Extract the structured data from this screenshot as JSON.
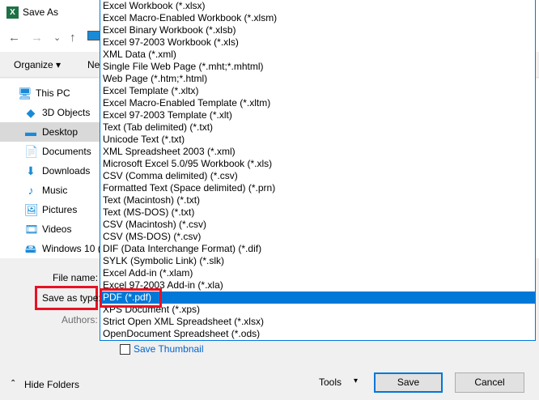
{
  "window": {
    "title": "Save As",
    "icon": "excel-icon"
  },
  "nav": {
    "back": "←",
    "forward": "→",
    "recent": "⌄",
    "up": "↑"
  },
  "toolbar": {
    "organize": "Organize ▾",
    "new_folder": "Ne"
  },
  "sidebar": {
    "items": [
      {
        "label": "This PC",
        "icon": "🖥"
      },
      {
        "label": "3D Objects",
        "icon": "◆"
      },
      {
        "label": "Desktop",
        "icon": "▬",
        "selected": true
      },
      {
        "label": "Documents",
        "icon": "📄"
      },
      {
        "label": "Downloads",
        "icon": "⬇"
      },
      {
        "label": "Music",
        "icon": "♪"
      },
      {
        "label": "Pictures",
        "icon": "🖼"
      },
      {
        "label": "Videos",
        "icon": "🎞"
      },
      {
        "label": "Windows 10 (",
        "icon": "🖴"
      }
    ]
  },
  "form": {
    "file_name_label": "File name:",
    "save_as_type_label": "Save as type:",
    "authors_label": "Authors:",
    "save_thumbnail": "Save Thumbnail"
  },
  "dropdown": {
    "selected_index": 24,
    "options": [
      "Excel Workbook (*.xlsx)",
      "Excel Macro-Enabled Workbook (*.xlsm)",
      "Excel Binary Workbook (*.xlsb)",
      "Excel 97-2003 Workbook (*.xls)",
      "XML Data (*.xml)",
      "Single File Web Page (*.mht;*.mhtml)",
      "Web Page (*.htm;*.html)",
      "Excel Template (*.xltx)",
      "Excel Macro-Enabled Template (*.xltm)",
      "Excel 97-2003 Template (*.xlt)",
      "Text (Tab delimited) (*.txt)",
      "Unicode Text (*.txt)",
      "XML Spreadsheet 2003 (*.xml)",
      "Microsoft Excel 5.0/95 Workbook (*.xls)",
      "CSV (Comma delimited) (*.csv)",
      "Formatted Text (Space delimited) (*.prn)",
      "Text (Macintosh) (*.txt)",
      "Text (MS-DOS) (*.txt)",
      "CSV (Macintosh) (*.csv)",
      "CSV (MS-DOS) (*.csv)",
      "DIF (Data Interchange Format) (*.dif)",
      "SYLK (Symbolic Link) (*.slk)",
      "Excel Add-in (*.xlam)",
      "Excel 97-2003 Add-in (*.xla)",
      "PDF (*.pdf)",
      "XPS Document (*.xps)",
      "Strict Open XML Spreadsheet (*.xlsx)",
      "OpenDocument Spreadsheet (*.ods)"
    ]
  },
  "footer": {
    "hide_folders": "Hide Folders",
    "tools": "Tools",
    "tools_arrow": "▾",
    "save": "Save",
    "cancel": "Cancel"
  },
  "colors": {
    "accent": "#0078d7",
    "highlight": "#e81123"
  }
}
